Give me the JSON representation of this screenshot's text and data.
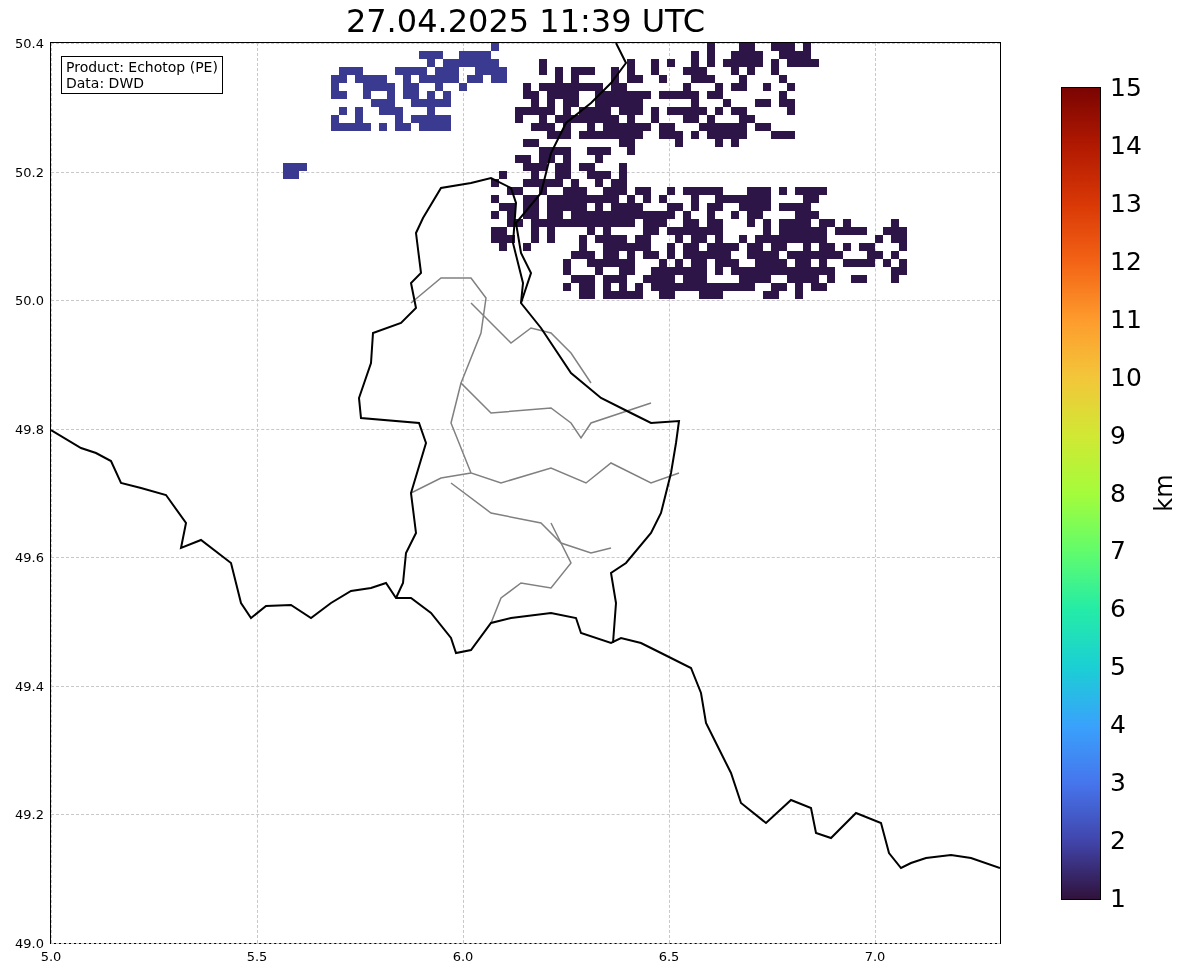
{
  "title": "27.04.2025 11:39 UTC",
  "legend_box": {
    "lines": [
      "Product: Echotop (PE)",
      "Data: DWD"
    ]
  },
  "x_axis": {
    "ticks": [
      "5.0",
      "5.5",
      "6.0",
      "6.5",
      "7.0"
    ]
  },
  "y_axis": {
    "ticks": [
      "50.4",
      "50.2",
      "50.0",
      "49.8",
      "49.6",
      "49.4",
      "49.2",
      "49.0"
    ]
  },
  "colorbar": {
    "label": "km",
    "ticks": [
      "15",
      "14",
      "13",
      "12",
      "11",
      "10",
      "9",
      "8",
      "7",
      "6",
      "5",
      "4",
      "3",
      "2",
      "1"
    ]
  }
}
